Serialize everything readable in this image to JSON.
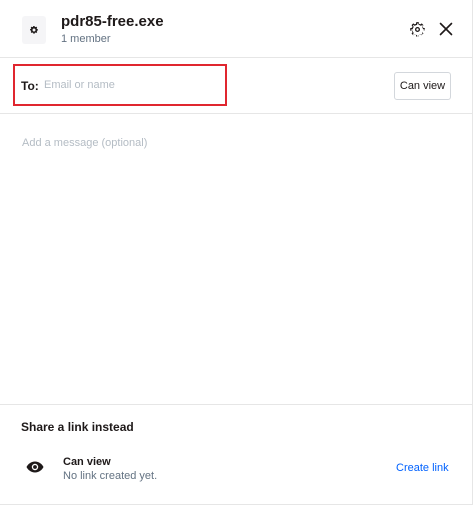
{
  "header": {
    "file_name": "pdr85-free.exe",
    "member_count": "1 member",
    "file_icon": "gear-icon",
    "settings_icon": "gear-icon",
    "close_icon": "close-icon"
  },
  "to_field": {
    "label": "To:",
    "placeholder": "Email or name",
    "value": "",
    "highlight_color": "#e0262f"
  },
  "permission_button": {
    "label": "Can view"
  },
  "message": {
    "placeholder": "Add a message (optional)",
    "value": ""
  },
  "share_link": {
    "title": "Share a link instead",
    "icon": "eye-icon",
    "permission": "Can view",
    "status": "No link created yet.",
    "action_label": "Create link",
    "action_color": "#0061fe"
  }
}
